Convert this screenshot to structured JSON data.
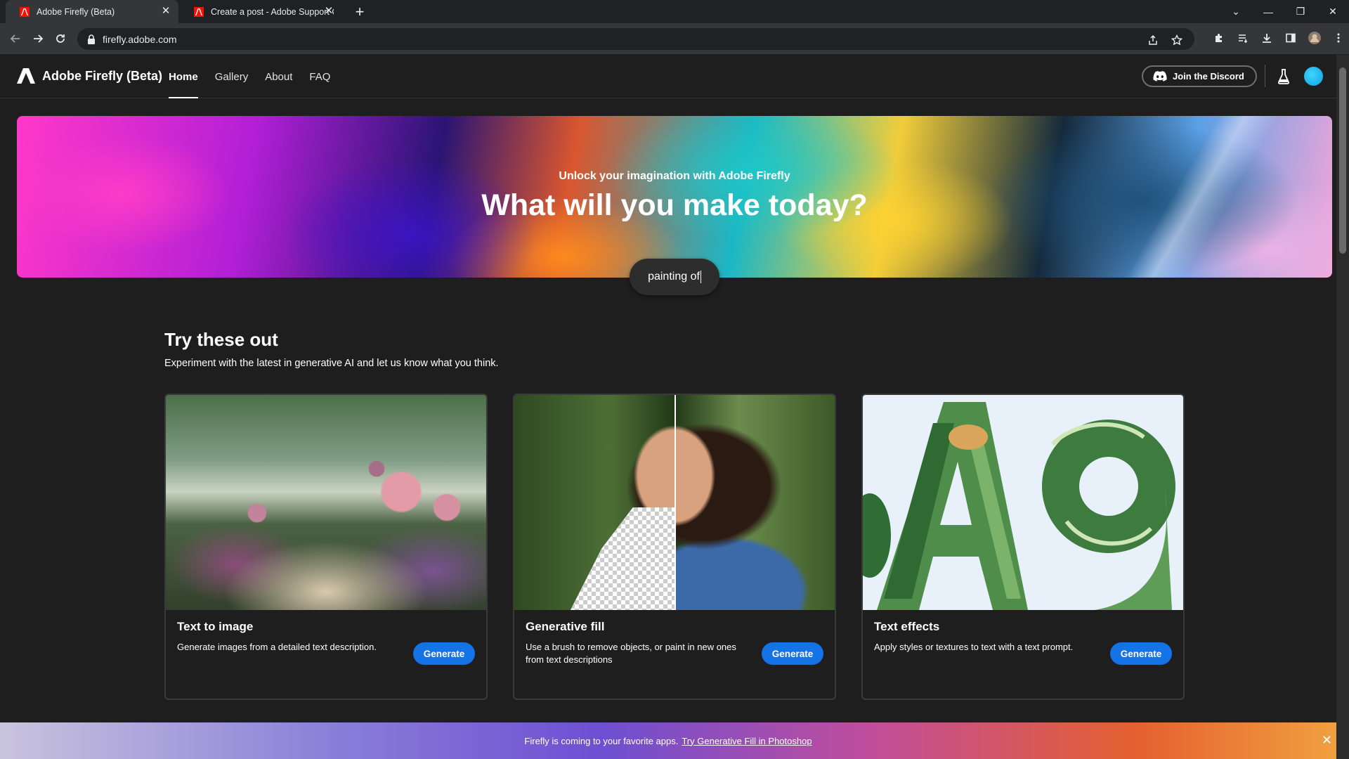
{
  "browser": {
    "tabs": [
      {
        "title": "Adobe Firefly (Beta)",
        "active": true
      },
      {
        "title": "Create a post - Adobe Support Community",
        "active": false
      }
    ],
    "url": "firefly.adobe.com"
  },
  "header": {
    "brand": "Adobe Firefly (Beta)",
    "nav": [
      "Home",
      "Gallery",
      "About",
      "FAQ"
    ],
    "active_nav": "Home",
    "discord_label": "Join the Discord"
  },
  "hero": {
    "subtitle": "Unlock your imagination with Adobe Firefly",
    "title": "What will you make today?",
    "prompt_value": "painting of"
  },
  "section": {
    "title": "Try these out",
    "subtitle": "Experiment with the latest in generative AI and let us know what you think."
  },
  "cards": [
    {
      "title": "Text to image",
      "desc": "Generate images from a detailed text description.",
      "button": "Generate"
    },
    {
      "title": "Generative fill",
      "desc": "Use a brush to remove objects, or paint in new ones from text descriptions",
      "button": "Generate"
    },
    {
      "title": "Text effects",
      "desc": "Apply styles or textures to text with a text prompt.",
      "button": "Generate"
    }
  ],
  "banner": {
    "text": "Firefly is coming to your favorite apps.",
    "link": "Try Generative Fill in Photoshop"
  },
  "colors": {
    "accent": "#1473e6",
    "page_bg": "#1e1e1e"
  }
}
